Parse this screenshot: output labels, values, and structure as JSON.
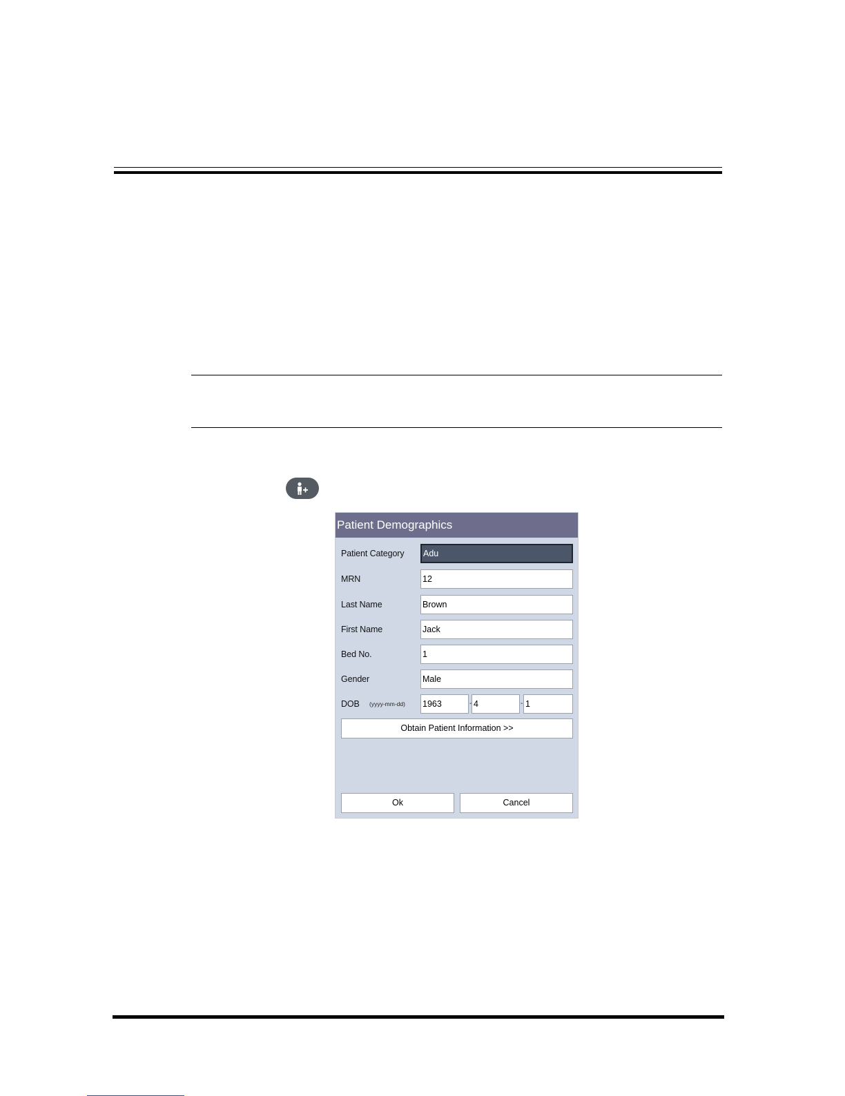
{
  "dialog": {
    "title": "Patient Demographics",
    "fields": [
      {
        "label": "Patient Category",
        "value": "Adu"
      },
      {
        "label": "MRN",
        "value": "12"
      },
      {
        "label": "Last Name",
        "value": "Brown"
      },
      {
        "label": "First Name",
        "value": "Jack"
      },
      {
        "label": "Bed No.",
        "value": "1"
      },
      {
        "label": "Gender",
        "value": "Male"
      }
    ],
    "dob": {
      "label": "DOB",
      "format": "(yyyy-mm-dd)",
      "year": "1963",
      "month": "4",
      "day": "1",
      "separator": "-"
    },
    "obtain_button": "Obtain Patient Information >>",
    "ok_button": "Ok",
    "cancel_button": "Cancel"
  },
  "icons": {
    "admit_patient": "person-plus-icon"
  },
  "colors": {
    "title_bar": "#6e6e8c",
    "dialog_bg": "#d0d8e6",
    "selected_field": "#4b5669",
    "icon_button": "#555b63"
  }
}
